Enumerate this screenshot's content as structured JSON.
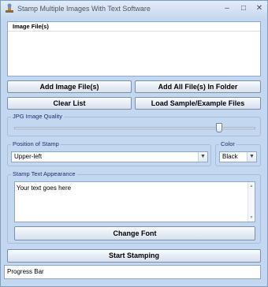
{
  "window": {
    "title": "Stamp Multiple Images With Text Software",
    "controls": [
      "minimize",
      "maximize",
      "close"
    ]
  },
  "file_list": {
    "column_header": "Image File(s)",
    "items": []
  },
  "buttons": {
    "add_images": "Add Image File(s)",
    "add_folder": "Add All File(s) In Folder",
    "clear_list": "Clear List",
    "load_sample": "Load Sample/Example Files",
    "change_font": "Change Font",
    "start_stamping": "Start Stamping"
  },
  "jpg_quality": {
    "label": "JPG Image Quality",
    "value_fraction": 0.86
  },
  "position": {
    "label": "Position of Stamp",
    "selected": "Upper-left"
  },
  "color": {
    "label": "Color",
    "selected": "Black"
  },
  "stamp_text": {
    "label": "Stamp Text Appearance",
    "value": "Your text goes here"
  },
  "status": {
    "progress_label": "Progress Bar"
  },
  "icons": {
    "app": "stamp-app-icon",
    "dropdown": "chevron-down-icon"
  },
  "colors": {
    "window_bg": "#c3d7f0",
    "group_label": "#1b2f6e"
  }
}
